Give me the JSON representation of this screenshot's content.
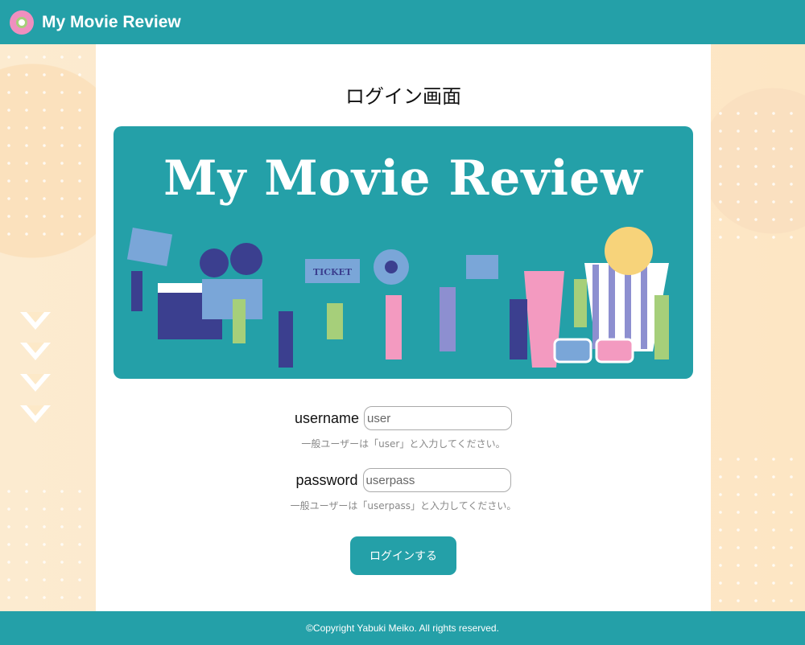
{
  "header": {
    "brand": "My Movie Review",
    "logo_icon": "film-reel-icon"
  },
  "page": {
    "title": "ログイン画面"
  },
  "banner": {
    "title": "My Movie Review",
    "ticket": "TICKET"
  },
  "form": {
    "username_label": "username",
    "username_placeholder": "user",
    "username_hint": "一般ユーザーは「user」と入力してください。",
    "password_label": "password",
    "password_placeholder": "userpass",
    "password_hint": "一般ユーザーは「userpass」と入力してください。",
    "submit": "ログインする"
  },
  "footer": {
    "copyright": "©Copyright Yabuki Meiko. All rights reserved."
  },
  "colors": {
    "primary": "#24a0a8",
    "background": "#fde9c8"
  }
}
